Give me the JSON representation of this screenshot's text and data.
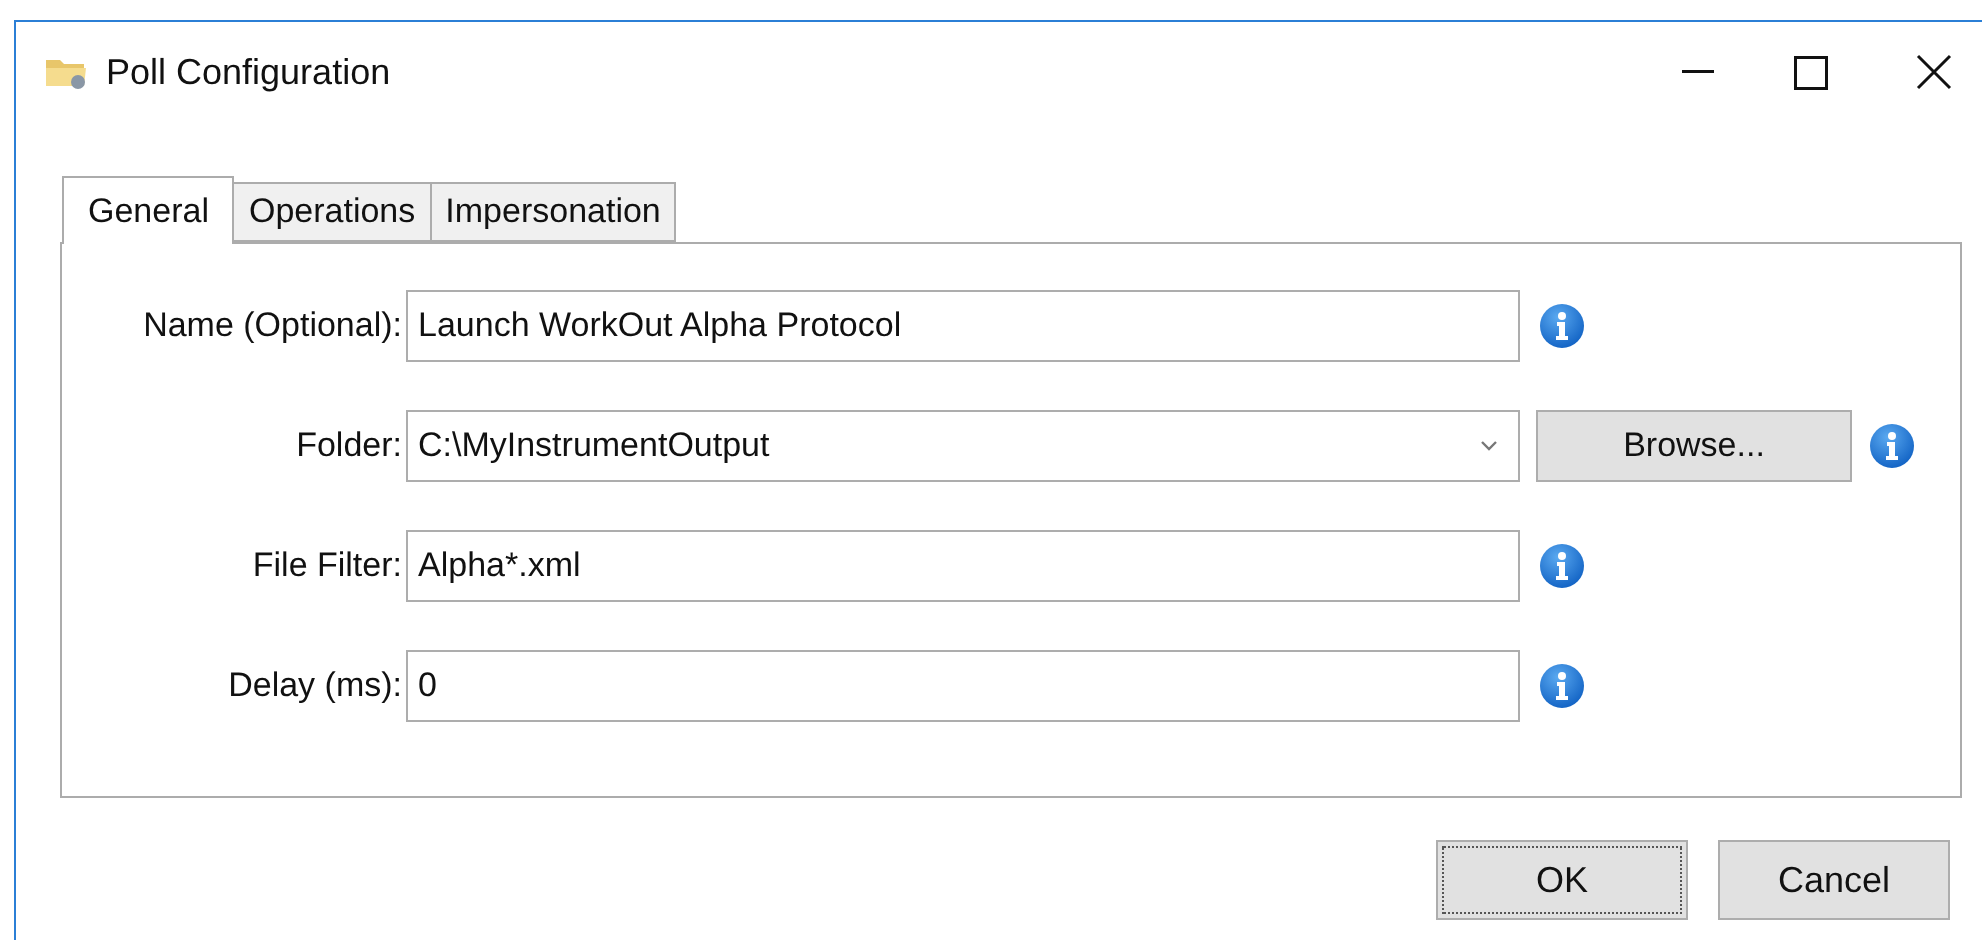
{
  "window": {
    "title": "Poll Configuration"
  },
  "tabs": [
    {
      "label": "General",
      "selected": true
    },
    {
      "label": "Operations",
      "selected": false
    },
    {
      "label": "Impersonation",
      "selected": false
    }
  ],
  "fields": [
    {
      "label": "Name (Optional):",
      "kind": "text",
      "value": "Launch WorkOut Alpha Protocol"
    },
    {
      "label": "Folder:",
      "kind": "combo",
      "value": "C:\\MyInstrumentOutput",
      "button": "Browse..."
    },
    {
      "label": "File Filter:",
      "kind": "text",
      "value": "Alpha*.xml"
    },
    {
      "label": "Delay (ms):",
      "kind": "text",
      "value": "0"
    }
  ],
  "buttons": [
    {
      "label": "OK",
      "default": true
    },
    {
      "label": "Cancel",
      "default": false
    }
  ]
}
